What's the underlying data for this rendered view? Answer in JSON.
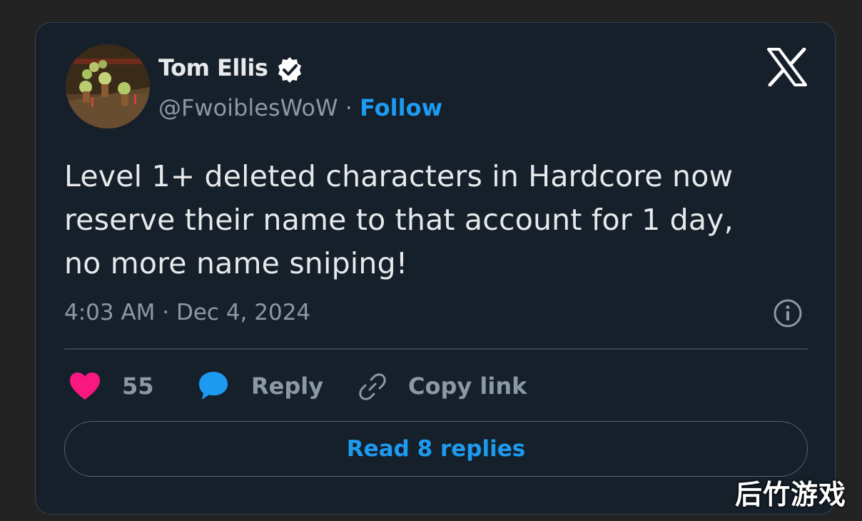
{
  "author": {
    "name": "Tom Ellis",
    "handle": "@FwoiblesWoW",
    "separator": "·",
    "follow_label": "Follow",
    "verified": true
  },
  "tweet": {
    "text_lines": [
      "Level 1+ deleted characters in Hardcore now",
      "reserve their name to that account for 1 day,",
      "no more name sniping!"
    ],
    "timestamp": "4:03 AM · Dec 4, 2024"
  },
  "actions": {
    "like_count": "55",
    "reply_label": "Reply",
    "copy_link_label": "Copy link"
  },
  "read_replies_label": "Read 8 replies",
  "watermark": "后竹游戏",
  "icons": {
    "logo": "x-logo-icon",
    "verified": "verified-badge-icon",
    "info": "info-icon",
    "like": "heart-icon",
    "reply": "speech-bubble-icon",
    "copy": "link-icon"
  },
  "colors": {
    "background": "#232323",
    "card": "#15202b",
    "accent": "#1d9bf0",
    "heart": "#f91880",
    "text": "#e7e9ea",
    "muted": "#8b98a5"
  }
}
